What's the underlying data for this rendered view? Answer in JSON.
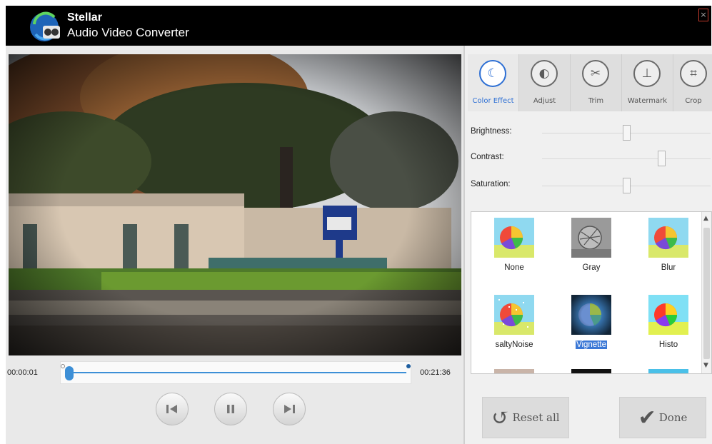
{
  "window": {
    "title_line1": "Stellar",
    "title_line2": "Audio Video Converter",
    "close_label": "×"
  },
  "player": {
    "current_time": "00:00:01",
    "total_time": "00:21:36",
    "progress_fraction": 0.0008,
    "controls": {
      "prev_icon": "previous-icon",
      "pause_icon": "pause-icon",
      "next_icon": "next-icon"
    }
  },
  "tabs": [
    {
      "label": "Color Effect",
      "icon": "moon-icon",
      "active": true
    },
    {
      "label": "Adjust",
      "icon": "contrast-icon",
      "active": false
    },
    {
      "label": "Trim",
      "icon": "scissors-icon",
      "active": false
    },
    {
      "label": "Watermark",
      "icon": "watermark-icon",
      "active": false
    },
    {
      "label": "Crop",
      "icon": "crop-icon",
      "active": false
    }
  ],
  "sliders": {
    "brightness": {
      "label": "Brightness:",
      "value": 0.5
    },
    "contrast": {
      "label": "Contrast:",
      "value": 0.72
    },
    "saturation": {
      "label": "Saturation:",
      "value": 0.5
    }
  },
  "effects": [
    {
      "name": "None",
      "selected": false
    },
    {
      "name": "Gray",
      "selected": false
    },
    {
      "name": "Blur",
      "selected": false
    },
    {
      "name": "saltyNoise",
      "selected": false
    },
    {
      "name": "Vignette",
      "selected": true
    },
    {
      "name": "Histo",
      "selected": false
    }
  ],
  "buttons": {
    "reset_label": "Reset all",
    "done_label": "Done"
  },
  "colors": {
    "accent": "#2d6fd4",
    "timeline": "#3d8fd6",
    "titlebar": "#000000"
  }
}
